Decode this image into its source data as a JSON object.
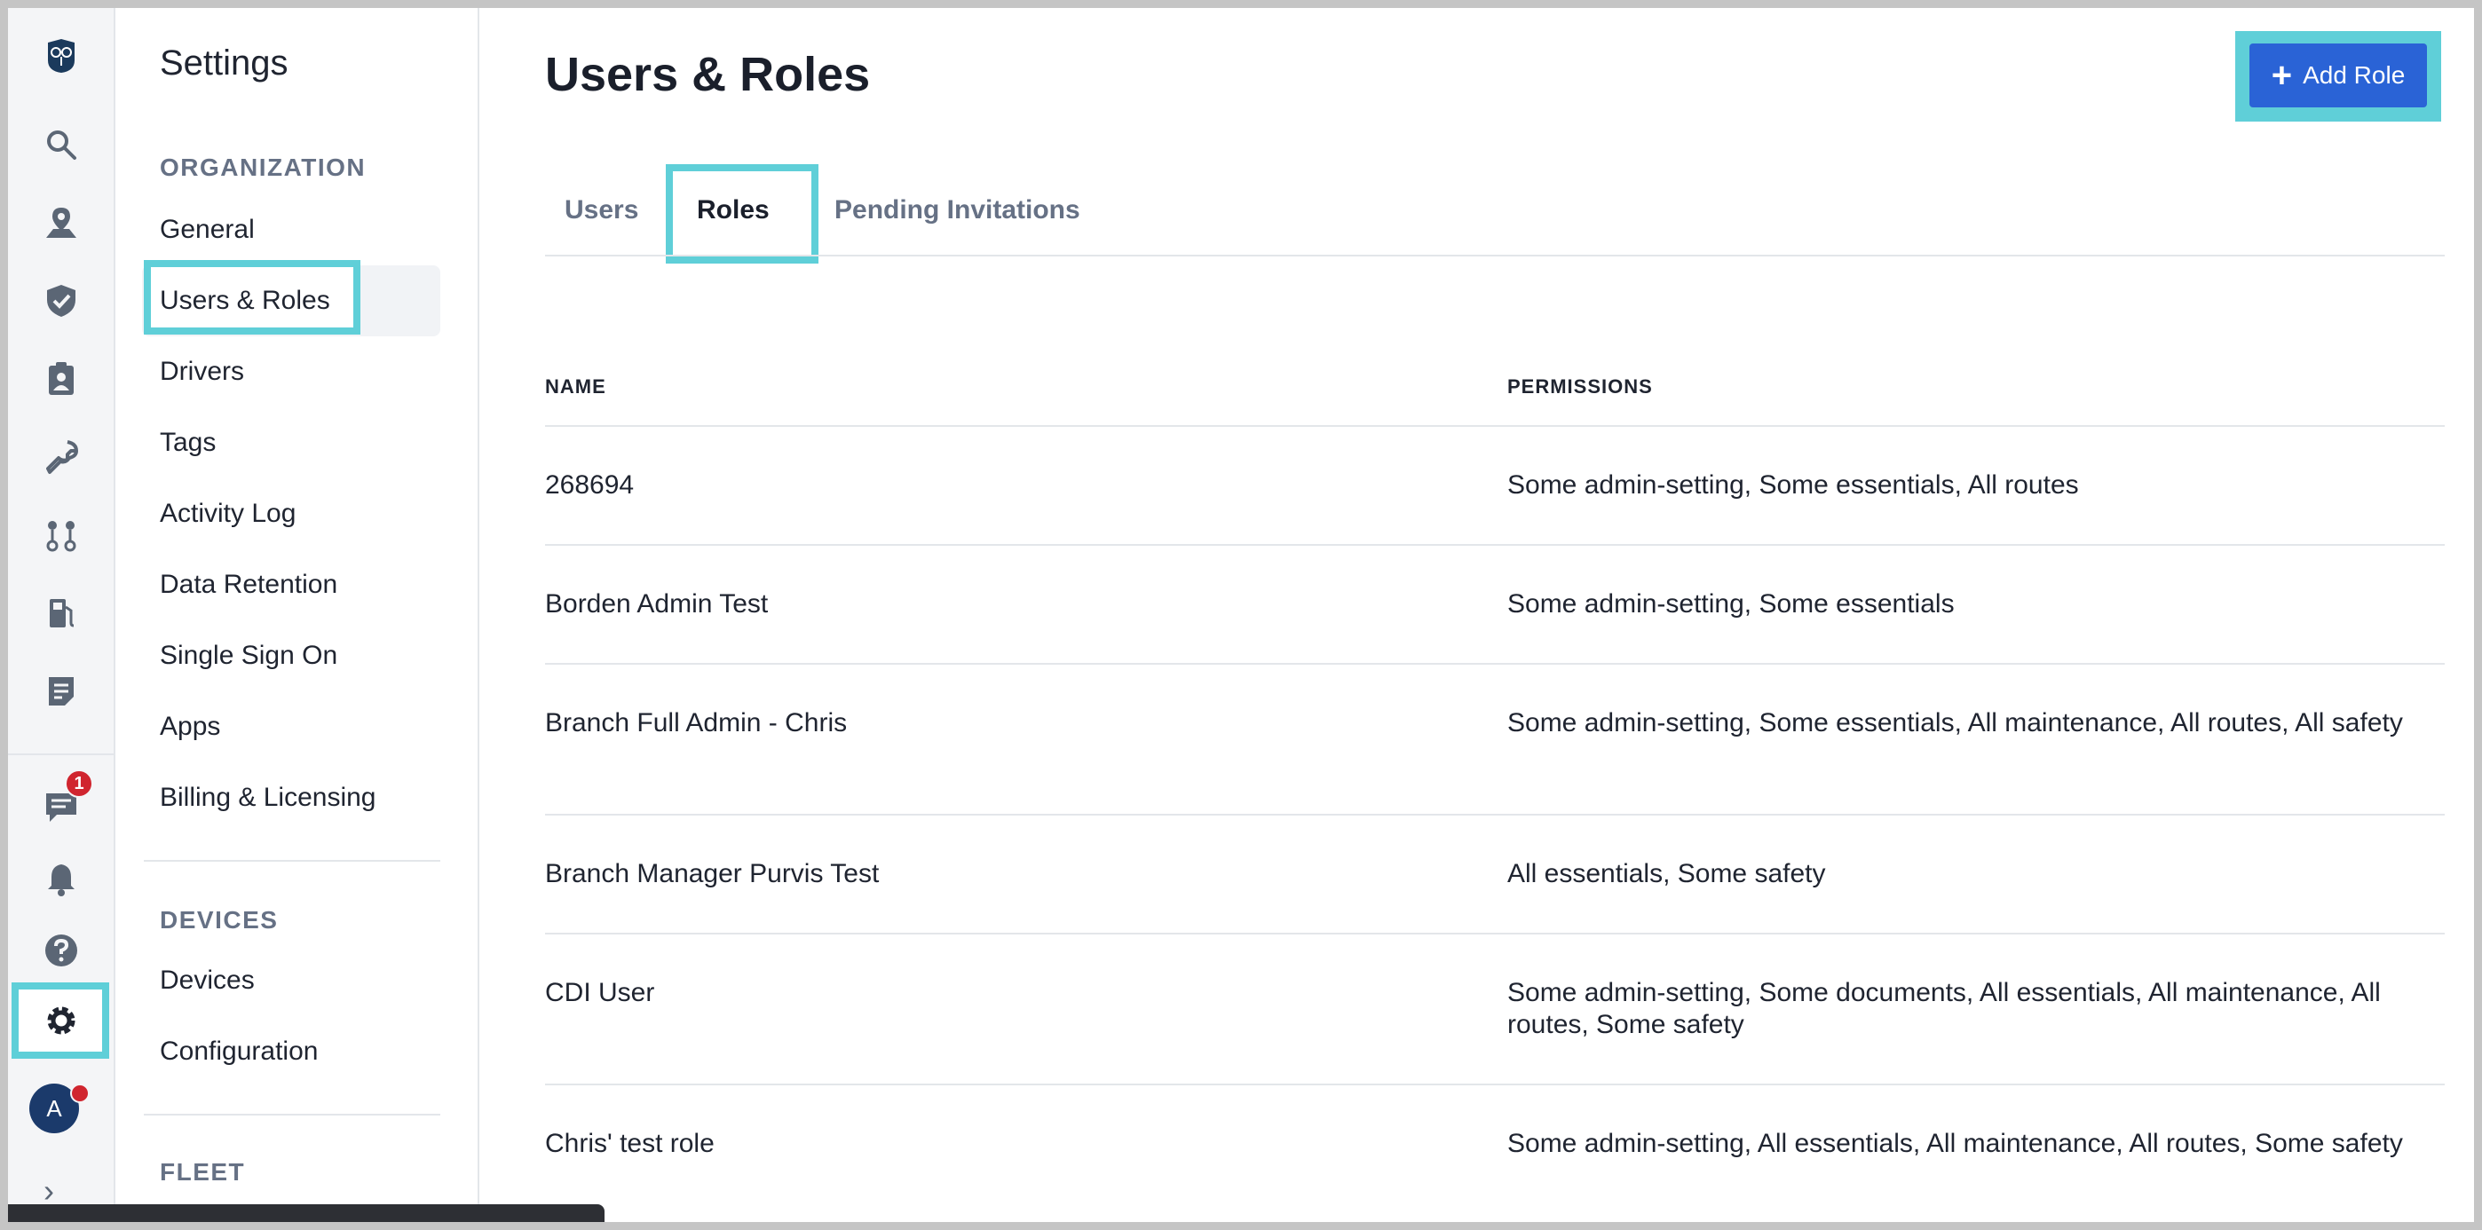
{
  "rail": {
    "icons": [
      "owl-logo-icon",
      "search-icon",
      "map-pin-icon",
      "shield-icon",
      "clipboard-user-icon",
      "wrench-icon",
      "route-icon",
      "fuel-icon",
      "document-icon"
    ],
    "bottom_icons": [
      "chat-icon",
      "bell-icon",
      "help-icon",
      "gear-icon"
    ],
    "chat_badge": "1",
    "avatar_initial": "A",
    "accent_color": "#5fcfd8"
  },
  "sidebar": {
    "title": "Settings",
    "sections": [
      {
        "heading": "ORGANIZATION",
        "items": [
          "General",
          "Users & Roles",
          "Drivers",
          "Tags",
          "Activity Log",
          "Data Retention",
          "Single Sign On",
          "Apps",
          "Billing & Licensing"
        ]
      },
      {
        "heading": "DEVICES",
        "items": [
          "Devices",
          "Configuration"
        ]
      },
      {
        "heading": "FLEET",
        "items": []
      }
    ],
    "active_item": "Users & Roles"
  },
  "main": {
    "title": "Users & Roles",
    "add_button_label": "Add Role",
    "button_color": "#2a63d6",
    "tabs": [
      "Users",
      "Roles",
      "Pending Invitations"
    ],
    "active_tab": "Roles",
    "table": {
      "headers": [
        "NAME",
        "PERMISSIONS"
      ],
      "rows": [
        {
          "name": "268694",
          "permissions": "Some admin-setting, Some essentials, All routes"
        },
        {
          "name": "Borden Admin Test",
          "permissions": "Some admin-setting, Some essentials"
        },
        {
          "name": "Branch Full Admin - Chris",
          "permissions": "Some admin-setting, Some essentials, All maintenance, All routes, All safety"
        },
        {
          "name": "Branch Manager Purvis Test",
          "permissions": "All essentials, Some safety"
        },
        {
          "name": "CDI User",
          "permissions": "Some admin-setting, Some documents, All essentials, All maintenance, All routes, Some safety"
        },
        {
          "name": "Chris' test role",
          "permissions": "Some admin-setting, All essentials, All maintenance, All routes, Some safety"
        }
      ]
    }
  }
}
